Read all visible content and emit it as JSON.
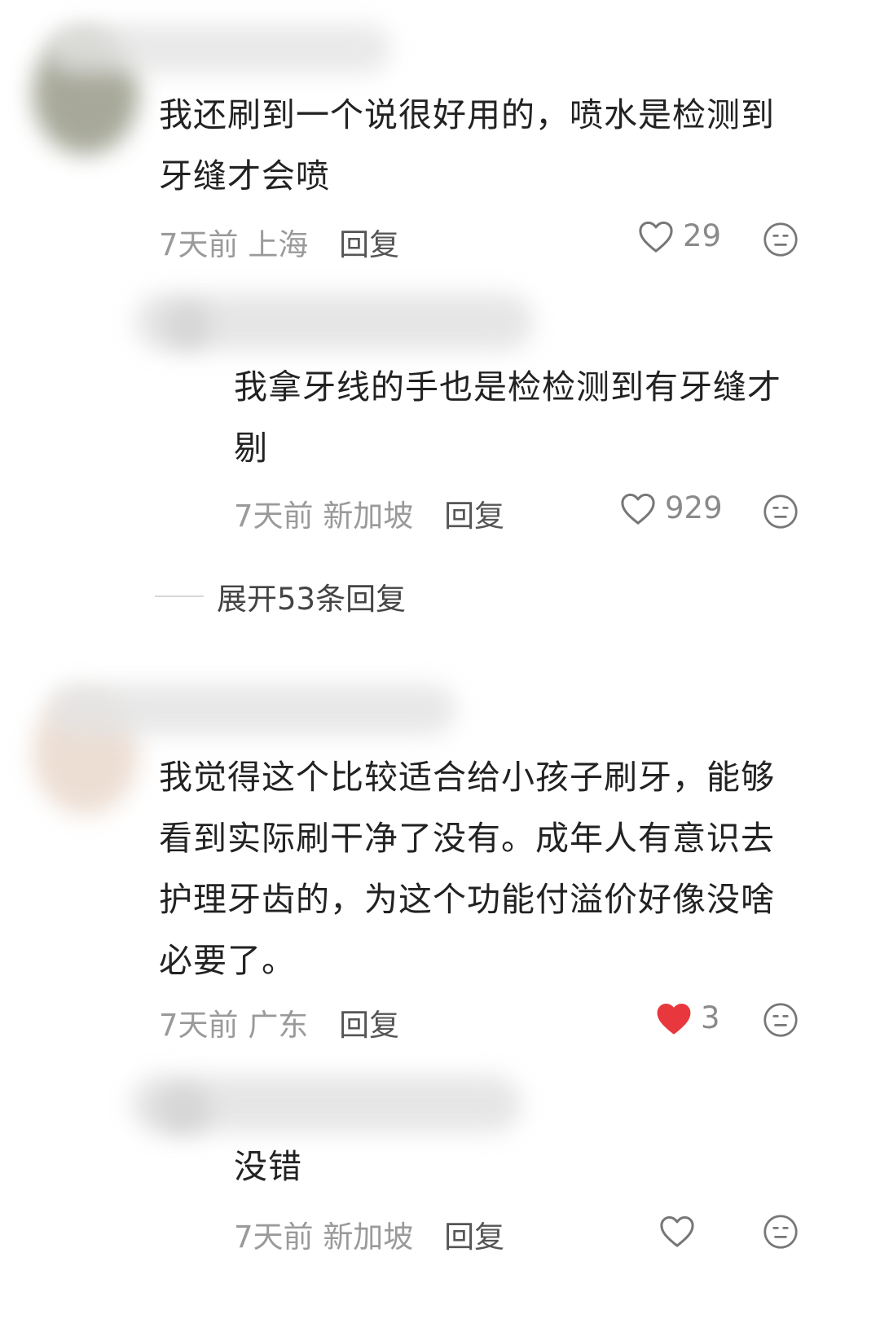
{
  "comments": [
    {
      "text": "我还刷到一个说很好用的，喷水是检测到牙缝才会喷",
      "time": "7天前",
      "location": "上海",
      "reply_label": "回复",
      "likes": "29",
      "liked": false,
      "replies": [
        {
          "text": "我拿牙线的手也是检检测到有牙缝才剔",
          "time": "7天前",
          "location": "新加坡",
          "reply_label": "回复",
          "likes": "929",
          "liked": false
        }
      ],
      "expand_label": "展开53条回复"
    },
    {
      "text": "我觉得这个比较适合给小孩子刷牙，能够看到实际刷干净了没有。成年人有意识去护理牙齿的，为这个功能付溢价好像没啥必要了。",
      "time": "7天前",
      "location": "广东",
      "reply_label": "回复",
      "likes": "3",
      "liked": true,
      "replies": [
        {
          "text": "没错",
          "time": "7天前",
          "location": "新加坡",
          "reply_label": "回复",
          "likes": "",
          "liked": false
        }
      ]
    }
  ],
  "colors": {
    "liked_heart": "#e8383d",
    "icon_gray": "#777777"
  },
  "icons": {
    "like": "heart-icon",
    "dislike": "meh-face-icon"
  }
}
